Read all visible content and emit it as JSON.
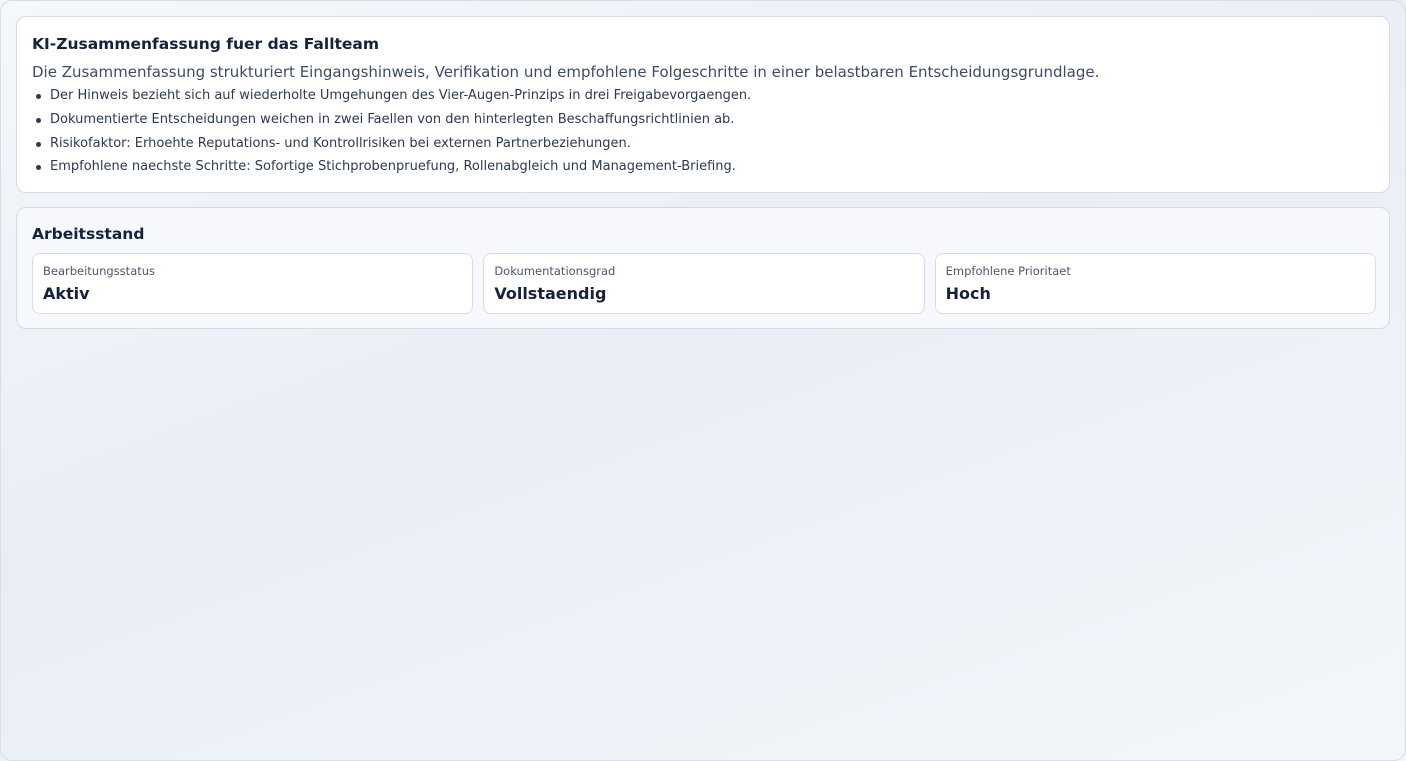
{
  "summary": {
    "title": "KI-Zusammenfassung fuer das Fallteam",
    "lead": "Die Zusammenfassung strukturiert Eingangshinweis, Verifikation und empfohlene Folgeschritte in einer belastbaren Entscheidungsgrundlage.",
    "items": [
      "Der Hinweis bezieht sich auf wiederholte Umgehungen des Vier-Augen-Prinzips in drei Freigabevorgaengen.",
      "Dokumentierte Entscheidungen weichen in zwei Faellen von den hinterlegten Beschaffungsrichtlinien ab.",
      "Risikofaktor: Erhoehte Reputations- und Kontrollrisiken bei externen Partnerbeziehungen.",
      "Empfohlene naechste Schritte: Sofortige Stichprobenpruefung, Rollenabgleich und Management-Briefing."
    ]
  },
  "status": {
    "title": "Arbeitsstand",
    "tiles": [
      {
        "label": "Bearbeitungsstatus",
        "value": "Aktiv"
      },
      {
        "label": "Dokumentationsgrad",
        "value": "Vollstaendig"
      },
      {
        "label": "Empfohlene Prioritaet",
        "value": "Hoch"
      }
    ]
  }
}
